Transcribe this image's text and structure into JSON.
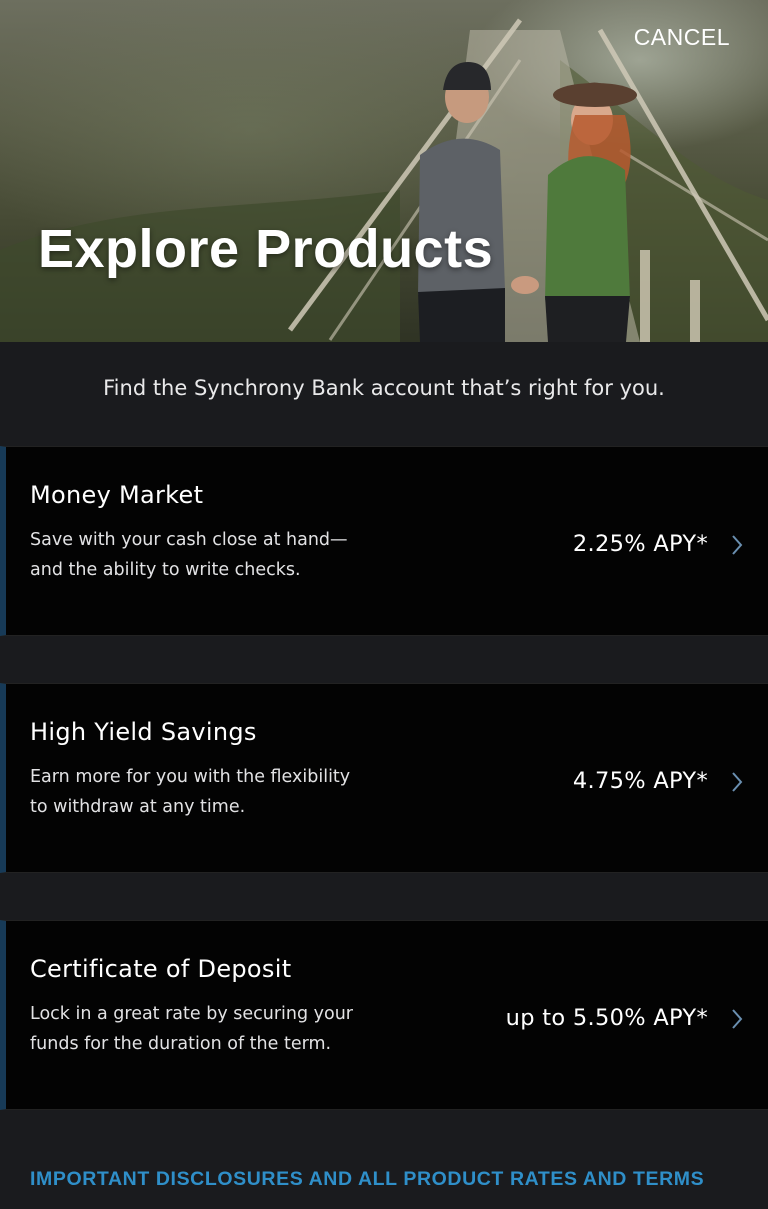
{
  "header": {
    "cancel_label": "CANCEL",
    "title": "Explore Products"
  },
  "intro": {
    "subtitle": "Find the Synchrony Bank account that’s right for you."
  },
  "products": [
    {
      "name": "Money Market",
      "description": "Save with your cash close at hand—and the ability to write checks.",
      "rate": "2.25% APY*"
    },
    {
      "name": "High Yield Savings",
      "description": "Earn more for you with the flexibility to withdraw at any time.",
      "rate": "4.75% APY*"
    },
    {
      "name": "Certificate of Deposit",
      "description": "Lock in a great rate by securing your funds for the duration of the term.",
      "rate": "up to 5.50% APY*"
    }
  ],
  "footer": {
    "disclosures_link": "IMPORTANT DISCLOSURES AND ALL PRODUCT RATES AND TERMS"
  },
  "colors": {
    "background": "#1a1b1e",
    "card_background": "#030303",
    "card_accent": "#173a57",
    "link": "#2f8fc9",
    "chevron": "#6a8fb0"
  },
  "icons": {
    "chevron": "chevron-right-icon"
  }
}
